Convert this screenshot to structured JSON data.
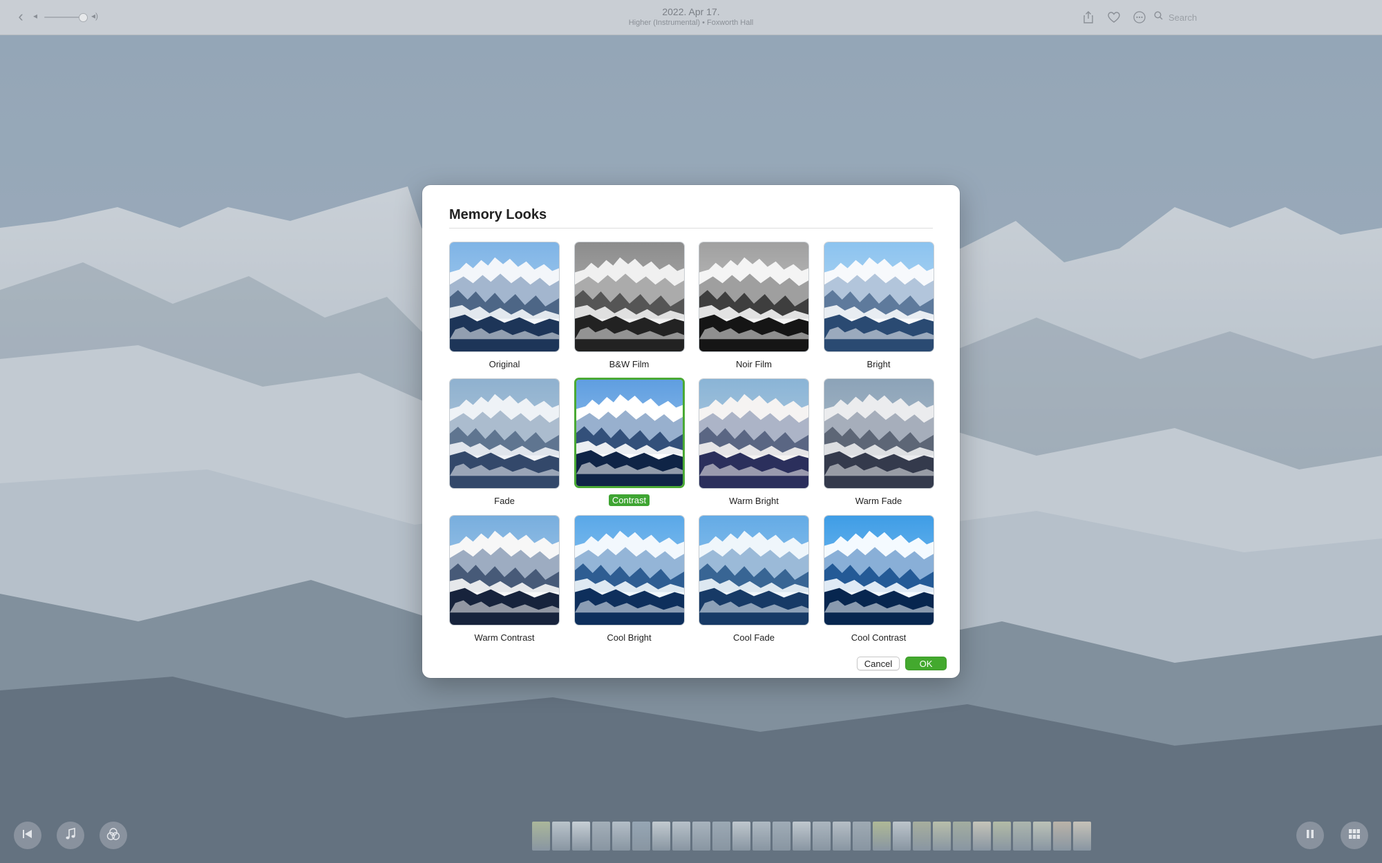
{
  "toolbar": {
    "title": "2022. Apr 17.",
    "subtitle": "Higher (Instrumental) • Foxworth Hall",
    "search_placeholder": "Search",
    "icons": [
      "back-icon",
      "volume-low-icon",
      "volume-high-icon",
      "share-icon",
      "heart-icon",
      "more-icon",
      "search-icon"
    ]
  },
  "dialog": {
    "title": "Memory Looks",
    "looks": [
      {
        "label": "Original",
        "style": "original"
      },
      {
        "label": "B&W Film",
        "style": "bw"
      },
      {
        "label": "Noir Film",
        "style": "noir"
      },
      {
        "label": "Bright",
        "style": "bright"
      },
      {
        "label": "Fade",
        "style": "fade"
      },
      {
        "label": "Contrast",
        "style": "contrast",
        "selected": true
      },
      {
        "label": "Warm Bright",
        "style": "warmbright"
      },
      {
        "label": "Warm Fade",
        "style": "warmfade"
      },
      {
        "label": "Warm Contrast",
        "style": "warmcontrast"
      },
      {
        "label": "Cool Bright",
        "style": "coolbright"
      },
      {
        "label": "Cool Fade",
        "style": "coolfade"
      },
      {
        "label": "Cool Contrast",
        "style": "coolcontrast"
      }
    ],
    "cancel_label": "Cancel",
    "ok_label": "OK"
  },
  "colors": {
    "accent_green": "#43a92e",
    "selection_green": "#4aa934"
  },
  "bottom": {
    "icons": [
      "skip-back-icon",
      "music-note-icon",
      "looks-icon",
      "pause-icon",
      "grid-icon"
    ]
  }
}
